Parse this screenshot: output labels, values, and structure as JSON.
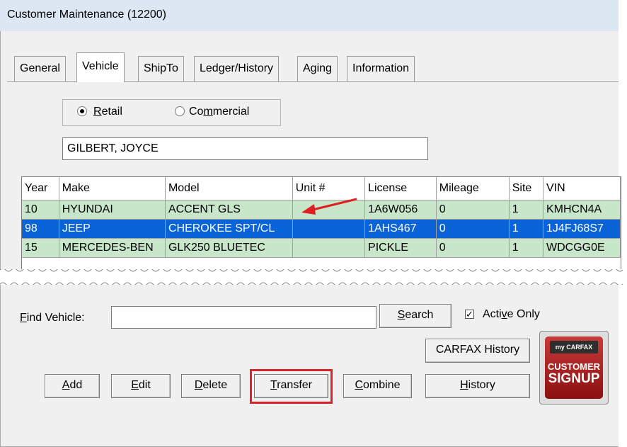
{
  "window": {
    "title": "Customer Maintenance (12200)"
  },
  "tabs": [
    {
      "label": "General",
      "active": false
    },
    {
      "label": "Vehicle",
      "active": true
    },
    {
      "label": "ShipTo",
      "active": false
    },
    {
      "label": "Ledger/History",
      "active": false
    },
    {
      "label": "Aging",
      "active": false
    },
    {
      "label": "Information",
      "active": false
    }
  ],
  "customer_type": {
    "options": [
      {
        "pre": "",
        "u": "R",
        "post": "etail",
        "selected": true
      },
      {
        "pre": "Co",
        "u": "m",
        "post": "mercial",
        "selected": false
      }
    ]
  },
  "customer_name": "GILBERT, JOYCE",
  "vehicle_grid": {
    "columns": [
      "Year",
      "Make",
      "Model",
      "Unit #",
      "License",
      "Mileage",
      "Site",
      "VIN"
    ],
    "rows": [
      {
        "cells": [
          "10",
          "HYUNDAI",
          "ACCENT GLS",
          "",
          "1A6W056",
          "0",
          "1",
          "KMHCN4A"
        ],
        "selected": false
      },
      {
        "cells": [
          "98",
          "JEEP",
          "CHEROKEE SPT/CL",
          "",
          "1AHS467",
          "0",
          "1",
          "1J4FJ68S7"
        ],
        "selected": true
      },
      {
        "cells": [
          "15",
          "MERCEDES-BEN",
          "GLK250 BLUETEC",
          "",
          "PICKLE",
          "0",
          "1",
          "WDCGG0E"
        ],
        "selected": false
      }
    ]
  },
  "find": {
    "label_pre": "",
    "label_u": "F",
    "label_post": "ind Vehicle:",
    "value": "",
    "search_u": "S",
    "search_post": "earch",
    "active_pre": "Acti",
    "active_u": "v",
    "active_post": "e Only",
    "active_checked": true
  },
  "buttons": {
    "carfax_history": "CARFAX History",
    "add_u": "A",
    "add_post": "dd",
    "edit_u": "E",
    "edit_post": "dit",
    "delete_u": "D",
    "delete_post": "elete",
    "transfer_u": "T",
    "transfer_post": "ransfer",
    "combine_u": "C",
    "combine_post": "ombine",
    "history_u": "H",
    "history_post": "istory"
  },
  "carfax_logo": {
    "brand": "my CARFAX",
    "line1": "CUSTOMER",
    "line2": "SIGNUP"
  },
  "colors": {
    "highlight_row": "#c8e6c9",
    "selected_row": "#0a64d8",
    "callout": "#d9242b",
    "arrow": "#e02020"
  }
}
